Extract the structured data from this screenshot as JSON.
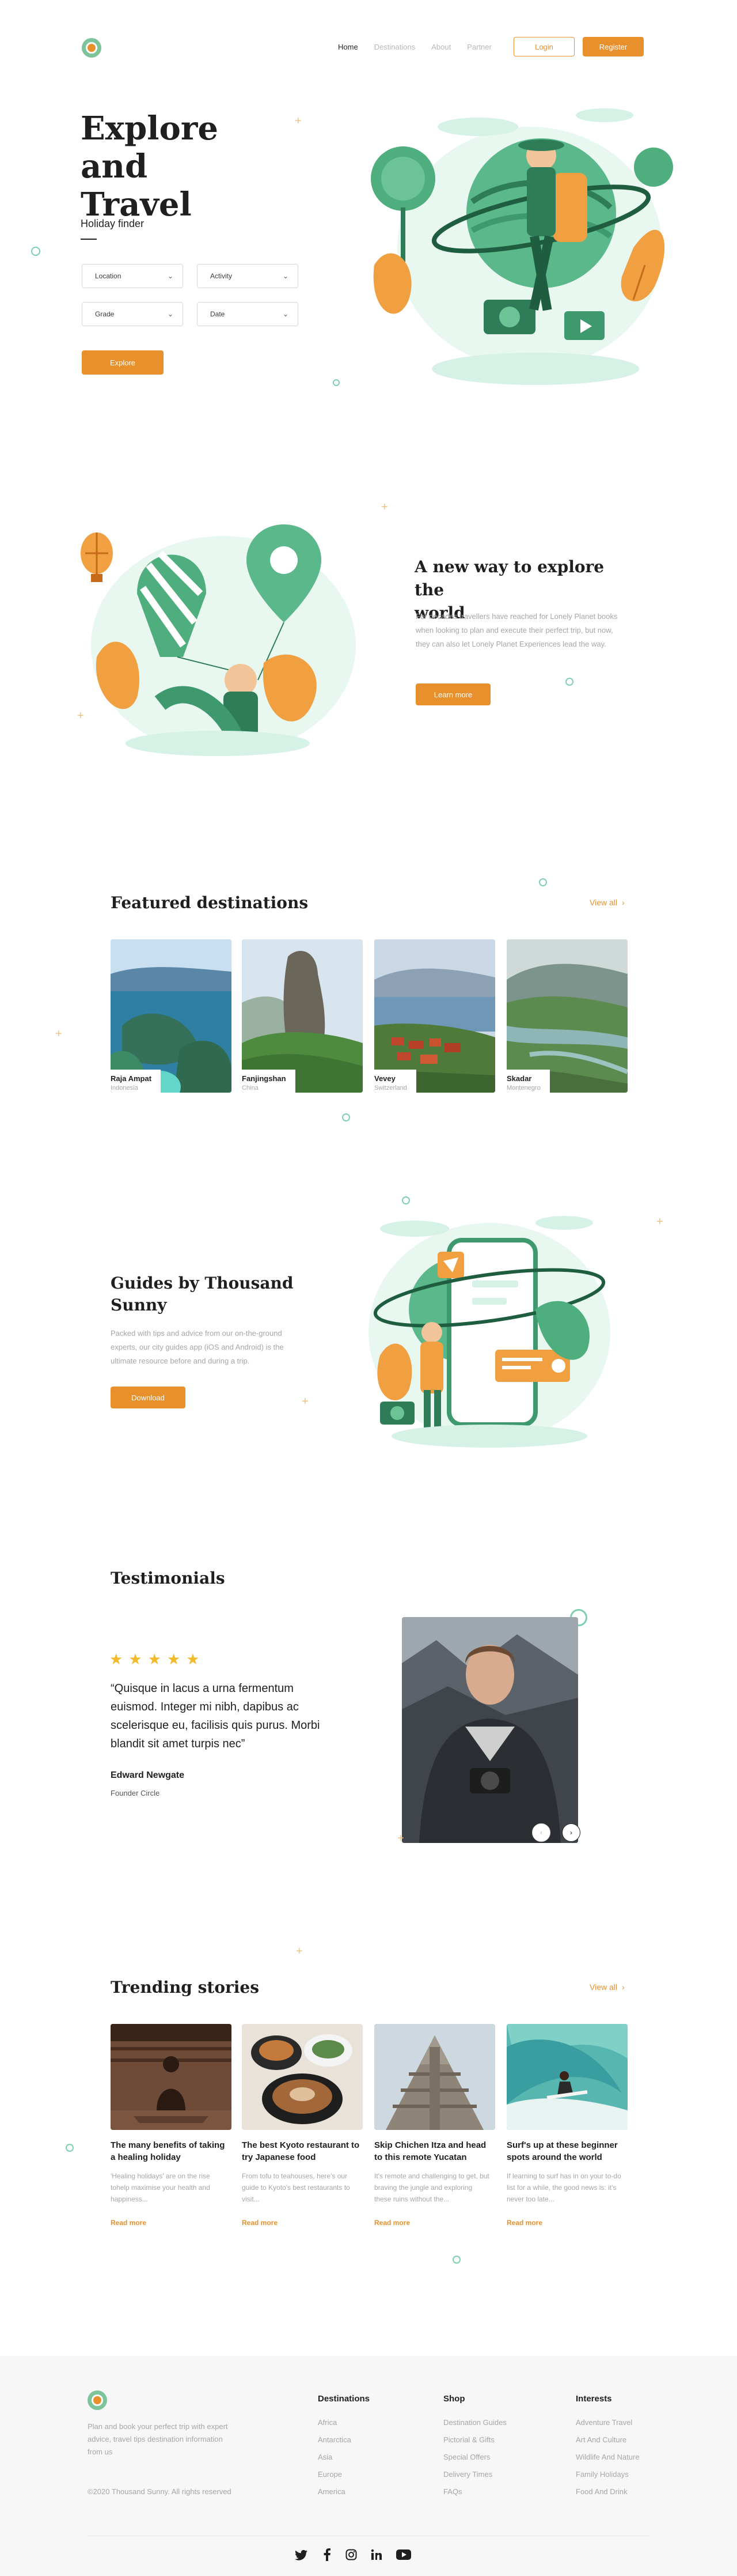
{
  "header": {
    "nav": [
      "Home",
      "Destinations",
      "About",
      "Partner"
    ],
    "login": "Login",
    "register": "Register"
  },
  "hero": {
    "title_line1": "Explore and",
    "title_line2": "Travel",
    "finder_label": "Holiday finder",
    "fields": [
      "Location",
      "Activity",
      "Grade",
      "Date"
    ],
    "cta": "Explore"
  },
  "explore": {
    "title_line1": "A new way to explore the",
    "title_line2": "world",
    "body": "For decades travellers have reached for Lonely Planet books when looking to plan and execute their perfect trip, but now, they can also let Lonely Planet Experiences lead the way.",
    "cta": "Learn more"
  },
  "featured": {
    "title": "Featured destinations",
    "view_all": "View all",
    "items": [
      {
        "name": "Raja Ampat",
        "country": "Indonesia"
      },
      {
        "name": "Fanjingshan",
        "country": "China"
      },
      {
        "name": "Vevey",
        "country": "Switzerland"
      },
      {
        "name": "Skadar",
        "country": "Montenegro"
      }
    ]
  },
  "guides": {
    "title_line1": "Guides by Thousand",
    "title_line2": "Sunny",
    "body": "Packed with tips and advice from our on-the-ground experts, our city guides app (iOS and Android) is the ultimate resource before and during a trip.",
    "cta": "Download"
  },
  "testimonials": {
    "title": "Testimonials",
    "rating": 5,
    "quote": "“Quisque in lacus a urna fermentum euismod. Integer mi nibh, dapibus ac scelerisque eu, facilisis quis purus. Morbi blandit sit amet turpis nec”",
    "author": "Edward Newgate",
    "role": "Founder Circle"
  },
  "stories": {
    "title": "Trending stories",
    "view_all": "View all",
    "read_more": "Read more",
    "items": [
      {
        "title": "The many benefits of taking a healing holiday",
        "excerpt": "'Healing holidays' are on the rise tohelp maximise your health and happiness..."
      },
      {
        "title": "The best Kyoto restaurant to try Japanese food",
        "excerpt": "From tofu to teahouses, here's our guide to Kyoto's best restaurants to visit..."
      },
      {
        "title": "Skip Chichen Itza and head to this remote Yucatan",
        "excerpt": "It's remote and challenging to get, but braving the jungle and exploring these ruins without the..."
      },
      {
        "title": "Surf's up at these beginner spots around the world",
        "excerpt": "If learning to surf has in on your to-do list for a while, the good news is: it's never too late..."
      }
    ]
  },
  "footer": {
    "tagline": "Plan and book your perfect trip with expert advice, travel tips destination information from us",
    "copyright": "©2020 Thousand Sunny. All rights reserved",
    "columns": [
      {
        "title": "Destinations",
        "links": [
          "Africa",
          "Antarctica",
          "Asia",
          "Europe",
          "America"
        ]
      },
      {
        "title": "Shop",
        "links": [
          "Destination Guides",
          "Pictorial & Gifts",
          "Special Offers",
          "Delivery Times",
          "FAQs"
        ]
      },
      {
        "title": "Interests",
        "links": [
          "Adventure Travel",
          "Art And Culture",
          "Wildlife And Nature",
          "Family Holidays",
          "Food And Drink"
        ]
      }
    ],
    "social": [
      "twitter-icon",
      "facebook-icon",
      "instagram-icon",
      "linkedin-icon",
      "youtube-icon"
    ]
  },
  "colors": {
    "accent": "#e7902c",
    "green": "#4fae7e",
    "star": "#f2b92b"
  }
}
